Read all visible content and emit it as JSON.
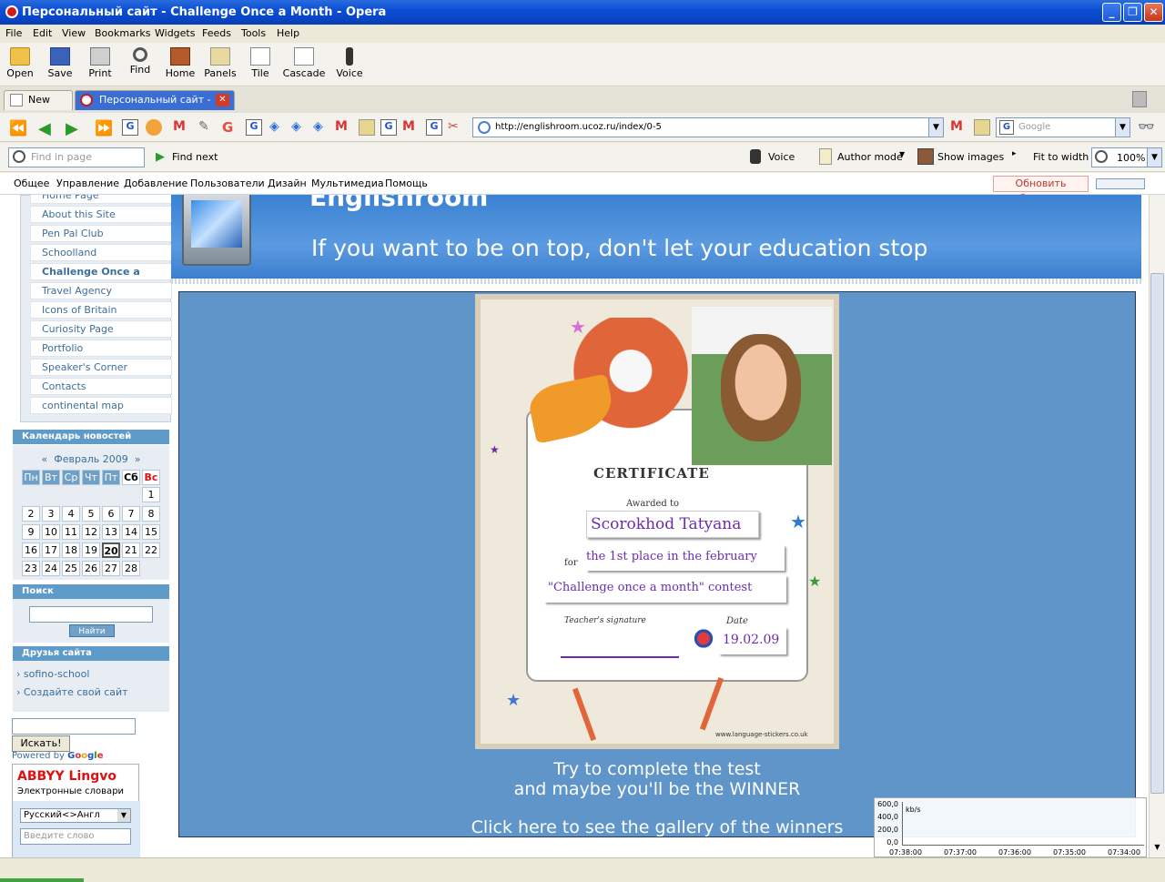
{
  "window": {
    "title": "Персональный сайт - Challenge Once a Month - Opera"
  },
  "menu": [
    "File",
    "Edit",
    "View",
    "Bookmarks",
    "Widgets",
    "Feeds",
    "Tools",
    "Help"
  ],
  "toolbar": [
    "Open",
    "Save",
    "Print",
    "Find",
    "Home",
    "Panels",
    "Tile",
    "Cascade",
    "Voice"
  ],
  "tabs": {
    "new": "New tab",
    "active": "Персональный сайт - C..."
  },
  "address": {
    "url": "http://englishroom.ucoz.ru/index/0-5",
    "search_placeholder": "Google"
  },
  "findbar": {
    "placeholder": "Find in page",
    "find_next": "Find next",
    "voice": "Voice",
    "author_mode": "Author mode",
    "show_images": "Show images",
    "fit": "Fit to width",
    "zoom": "100%"
  },
  "panel": {
    "items": [
      "Общее",
      "Управление",
      "Добавление",
      "Пользователи",
      "Дизайн",
      "Мультимедиа",
      "Помощь"
    ],
    "refresh": "Обновить браузер"
  },
  "sidebar": {
    "links": [
      "Home Page",
      "About this Site",
      "Pen Pal Club",
      "Schoolland",
      "Challenge Once a Month",
      "Travel Agency",
      "Icons of Britain",
      "Curiosity Page",
      "Portfolio",
      "Speaker's Corner",
      "Contacts",
      "continental map"
    ],
    "calendar_title": "Календарь новостей",
    "month": "Февраль 2009",
    "weekdays": [
      "Пн",
      "Вт",
      "Ср",
      "Чт",
      "Пт",
      "Сб",
      "Вс"
    ],
    "search_title": "Поиск",
    "search_button": "Найти",
    "friends_title": "Друзья сайта",
    "friends": [
      "sofino-school",
      "Создайте свой сайт"
    ],
    "google_button": "Искать!",
    "powered": "Powered by",
    "google_word": "Google",
    "lingvo_title": "ABBYY Lingvo",
    "lingvo_sub": "Электронные словари",
    "lingvo_lang": "Русский<>Англ",
    "lingvo_placeholder": "Введите слово"
  },
  "header": {
    "site_name": "Englishroom",
    "slogan": "If you want to be on top, don't let your education stop"
  },
  "certificate": {
    "title": "CERTIFICATE",
    "awarded": "Awarded to",
    "name": "Scorokhod Tatyana",
    "for_label": "for",
    "place": "the 1st place in the february",
    "contest": "\"Challenge once a month\" contest",
    "sig_label": "Teacher's signature",
    "date_label": "Date",
    "date": "19.02.09",
    "credit": "www.language-stickers.co.uk"
  },
  "content": {
    "line1": "Try to complete the test",
    "line2": "and maybe you'll be the WINNER",
    "link": "Click here to see the gallery of the winners"
  },
  "netgraph": {
    "unit": "kb/s",
    "y": [
      "600,0",
      "400,0",
      "200,0",
      "0,0"
    ],
    "times": [
      "07:38:00",
      "07:37:00",
      "07:36:00",
      "07:35:00",
      "07:34:00"
    ]
  }
}
